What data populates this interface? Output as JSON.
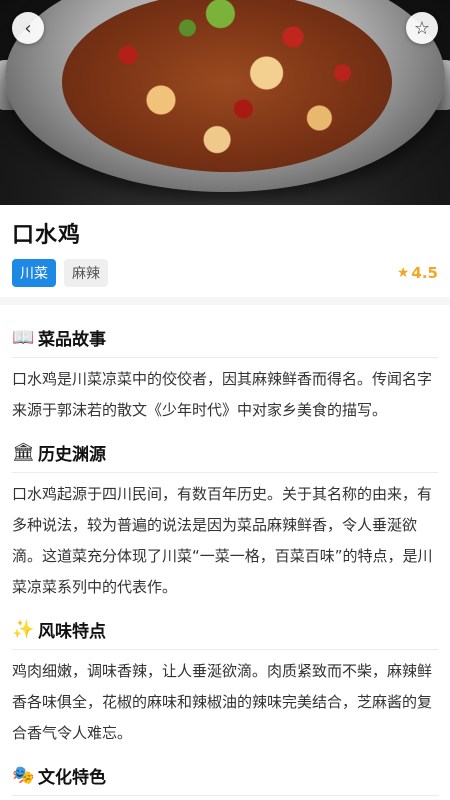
{
  "nav": {
    "back_icon": "‹",
    "favorite_icon": "☆"
  },
  "dish": {
    "name": "口水鸡",
    "tags": [
      "川菜",
      "麻辣"
    ],
    "rating": "4.5",
    "rating_star": "★"
  },
  "sections": [
    {
      "icon": "📖",
      "icon_name": "book-icon",
      "title": "菜品故事",
      "text": "口水鸡是川菜凉菜中的佼佼者，因其麻辣鲜香而得名。传闻名字来源于郭沫若的散文《少年时代》中对家乡美食的描写。"
    },
    {
      "icon": "🏛",
      "icon_name": "museum-icon",
      "title": "历史渊源",
      "text": "口水鸡起源于四川民间，有数百年历史。关于其名称的由来，有多种说法，较为普遍的说法是因为菜品麻辣鲜香，令人垂涎欲滴。这道菜充分体现了川菜“一菜一格，百菜百味”的特点，是川菜凉菜系列中的代表作。"
    },
    {
      "icon": "✨",
      "icon_name": "sparkles-icon",
      "title": "风味特点",
      "text": "鸡肉细嫩，调味香辣，让人垂涎欲滴。肉质紧致而不柴，麻辣鲜香各味俱全，花椒的麻味和辣椒油的辣味完美结合，芝麻酱的复合香气令人难忘。"
    },
    {
      "icon": "🎭",
      "icon_name": "theater-masks-icon",
      "title": "文化特色",
      "text": ""
    }
  ]
}
